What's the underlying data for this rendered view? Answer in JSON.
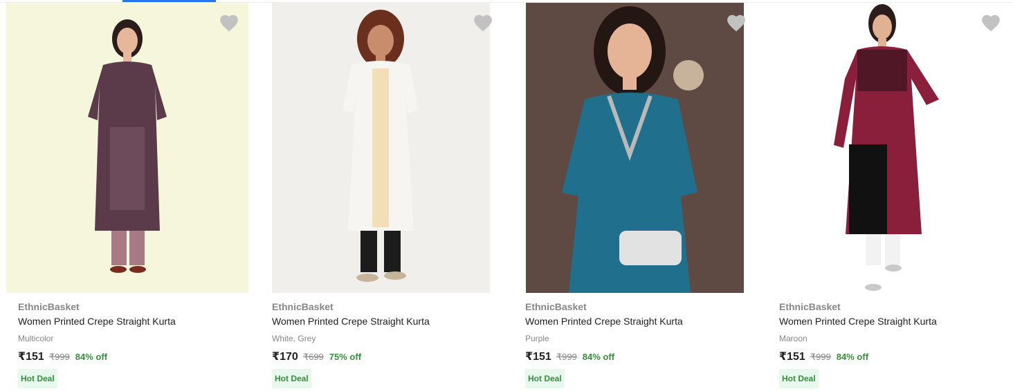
{
  "products": [
    {
      "brand": "EthnicBasket",
      "title": "Women Printed Crepe Straight Kurta",
      "color": "Multicolor",
      "price": "₹151",
      "mrp": "₹999",
      "discount": "84% off",
      "badge": "Hot Deal",
      "image_bg": "#f5f6dc",
      "kurta_color": "#5b3a4a"
    },
    {
      "brand": "EthnicBasket",
      "title": "Women Printed Crepe Straight Kurta",
      "color": "White, Grey",
      "price": "₹170",
      "mrp": "₹699",
      "discount": "75% off",
      "badge": "Hot Deal",
      "image_bg": "#f1efec",
      "kurta_color": "#f7f5f1"
    },
    {
      "brand": "EthnicBasket",
      "title": "Women Printed Crepe Straight Kurta",
      "color": "Purple",
      "price": "₹151",
      "mrp": "₹999",
      "discount": "84% off",
      "badge": "Hot Deal",
      "image_bg": "#5f4a43",
      "kurta_color": "#1f6f8d"
    },
    {
      "brand": "EthnicBasket",
      "title": "Women Printed Crepe Straight Kurta",
      "color": "Maroon",
      "price": "₹151",
      "mrp": "₹999",
      "discount": "84% off",
      "badge": "Hot Deal",
      "image_bg": "#ffffff",
      "kurta_color": "#8a1f3c"
    }
  ],
  "colors": {
    "wishlist_icon": "#c2c2c2",
    "discount_green": "#388e3c",
    "badge_bg": "#e7f8ec",
    "accent_blue": "#2874f0"
  },
  "icons": {
    "wishlist": "heart-icon"
  }
}
